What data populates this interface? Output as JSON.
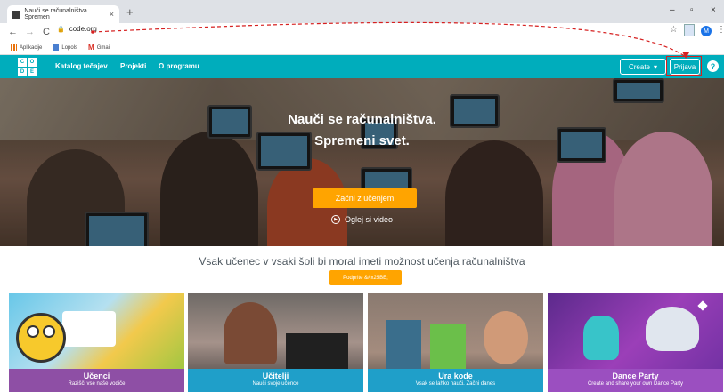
{
  "browser": {
    "tab_title": "Nauči se računalništva. Spremen",
    "tab_close": "×",
    "new_tab": "+",
    "window_controls": [
      "–",
      "▫",
      "×"
    ],
    "nav": {
      "back": "←",
      "forward": "→",
      "reload": "C"
    },
    "url": "code.org",
    "avatar_letter": "M",
    "bookmarks": [
      "Aplikacije",
      "Lopols",
      "Gmail"
    ]
  },
  "header": {
    "logo_letters": [
      "C",
      "O",
      "D",
      "E"
    ],
    "nav_links": [
      "Katalog tečajev",
      "Projekti",
      "O programu"
    ],
    "create_label": "Create",
    "signin_label": "Prijava",
    "help_label": "?",
    "accent_color": "#00adbc"
  },
  "hero": {
    "title_line1": "Nauči se računalništva.",
    "title_line2": "Spremeni svet.",
    "cta_label": "Začni z učenjem",
    "video_label": "Oglej si video"
  },
  "main": {
    "tagline": "Vsak učenec v vsaki šoli bi moral imeti možnost učenja računalništva",
    "support_label": "Podprite &#x25BE;"
  },
  "cards": [
    {
      "title": "Učenci",
      "subtitle": "Razišči vse naše vodiče",
      "color": "#8e4fa5"
    },
    {
      "title": "Učitelji",
      "subtitle": "Nauči svoje učence",
      "color": "#1f9fc9"
    },
    {
      "title": "Ura kode",
      "subtitle": "Vsak se lahko nauči. Začni danes",
      "color": "#1f9fc9"
    },
    {
      "title": "Dance Party",
      "subtitle": "Create and share your own Dance Party",
      "color": "#9b4fc0"
    }
  ]
}
